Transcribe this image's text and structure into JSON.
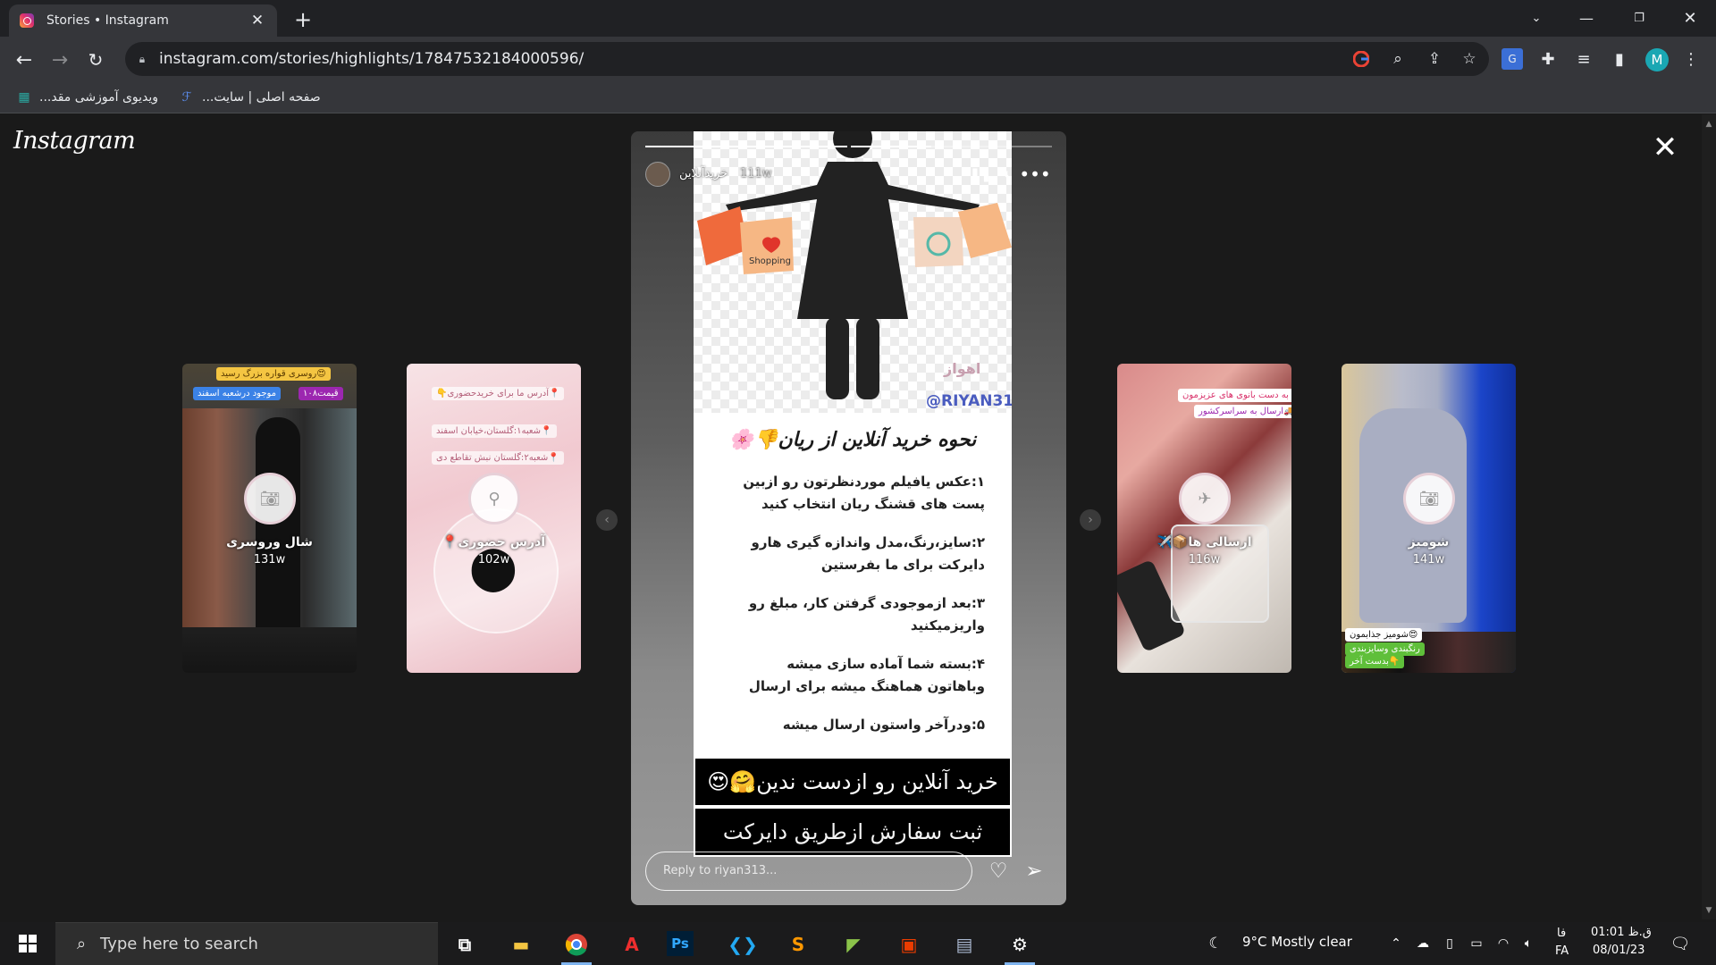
{
  "browser": {
    "tab_title": "Stories • Instagram",
    "url": "instagram.com/stories/highlights/17847532184000596/",
    "bookmarks": [
      {
        "label": "صفحه اصلی | سایت..."
      },
      {
        "label": "ویدیوی آموزشی مقد..."
      }
    ],
    "profile_initial": "M"
  },
  "instagram": {
    "logo": "Instagram",
    "main_story": {
      "username": "خریدآنلاین",
      "time": "111w",
      "city": "اهواز",
      "handle": "@RIYAN313",
      "title": "نحوه خرید آنلاین از ریان👎🌸",
      "steps": [
        "۱:عکس یافیلم موردنظرتون رو ازبین پست های قشنگ ریان انتخاب کنید",
        "۲:سایز،رنگ،مدل واندازه گیری هارو دایرکت برای ما بفرستین",
        "۳:بعد ازموجودی گرفتن کار، مبلغ رو واریزمیکنید",
        "۴:بسته شما آماده سازی میشه وباهاتون هماهنگ میشه برای ارسال",
        "۵:ودرآخر واستون ارسال میشه"
      ],
      "banner1": "خرید آنلاین رو ازدست ندین🤗😍",
      "banner2": "ثبت سفارش ازطریق دایرکت",
      "shopping_label": "Shopping",
      "reply_placeholder": "Reply to riyan313...",
      "progress": [
        1.0,
        0.4
      ]
    },
    "side_stories": [
      {
        "name": "شال وروسری",
        "time": "131w",
        "sticker1": "روسری قواره بزرگ رسید😍",
        "sticker2": "موجود درشعبه اسفند",
        "sticker3": "قیمت۱۰۸"
      },
      {
        "name": "📍آدرس حضوری",
        "time": "102w",
        "sticker1": "📍آدرس ما برای خریدحضوری👇",
        "sticker2": "📍شعبه۱:گلستان،خیابان اسفند",
        "sticker3": "📍شعبه۲:گلستان نبش تقاطع دی"
      },
      {
        "name": "✈️📦ارسالی ها",
        "time": "116w",
        "sticker1": "بسته به دست بانوی های عزیزمون🥰",
        "sticker2": "ارسال به سراسرکشور🚚✈️"
      },
      {
        "name": "شومیز",
        "time": "141w",
        "sticker1": "شومیز جذابمون😍",
        "sticker2": "رنگبندی وسایزبندی",
        "sticker3": "بدست آخر👇"
      }
    ]
  },
  "taskbar": {
    "search_placeholder": "Type here to search",
    "weather": "9°C  Mostly clear",
    "lang_top": "فا",
    "lang_bottom": "FA",
    "time": "01:01 ق.ظ",
    "date": "08/01/23"
  },
  "colors": {
    "chrome_dark": "#202124",
    "chrome_toolbar": "#35363a",
    "ig_bg": "#1a1a1a",
    "handle_blue": "#4a5cbf"
  }
}
